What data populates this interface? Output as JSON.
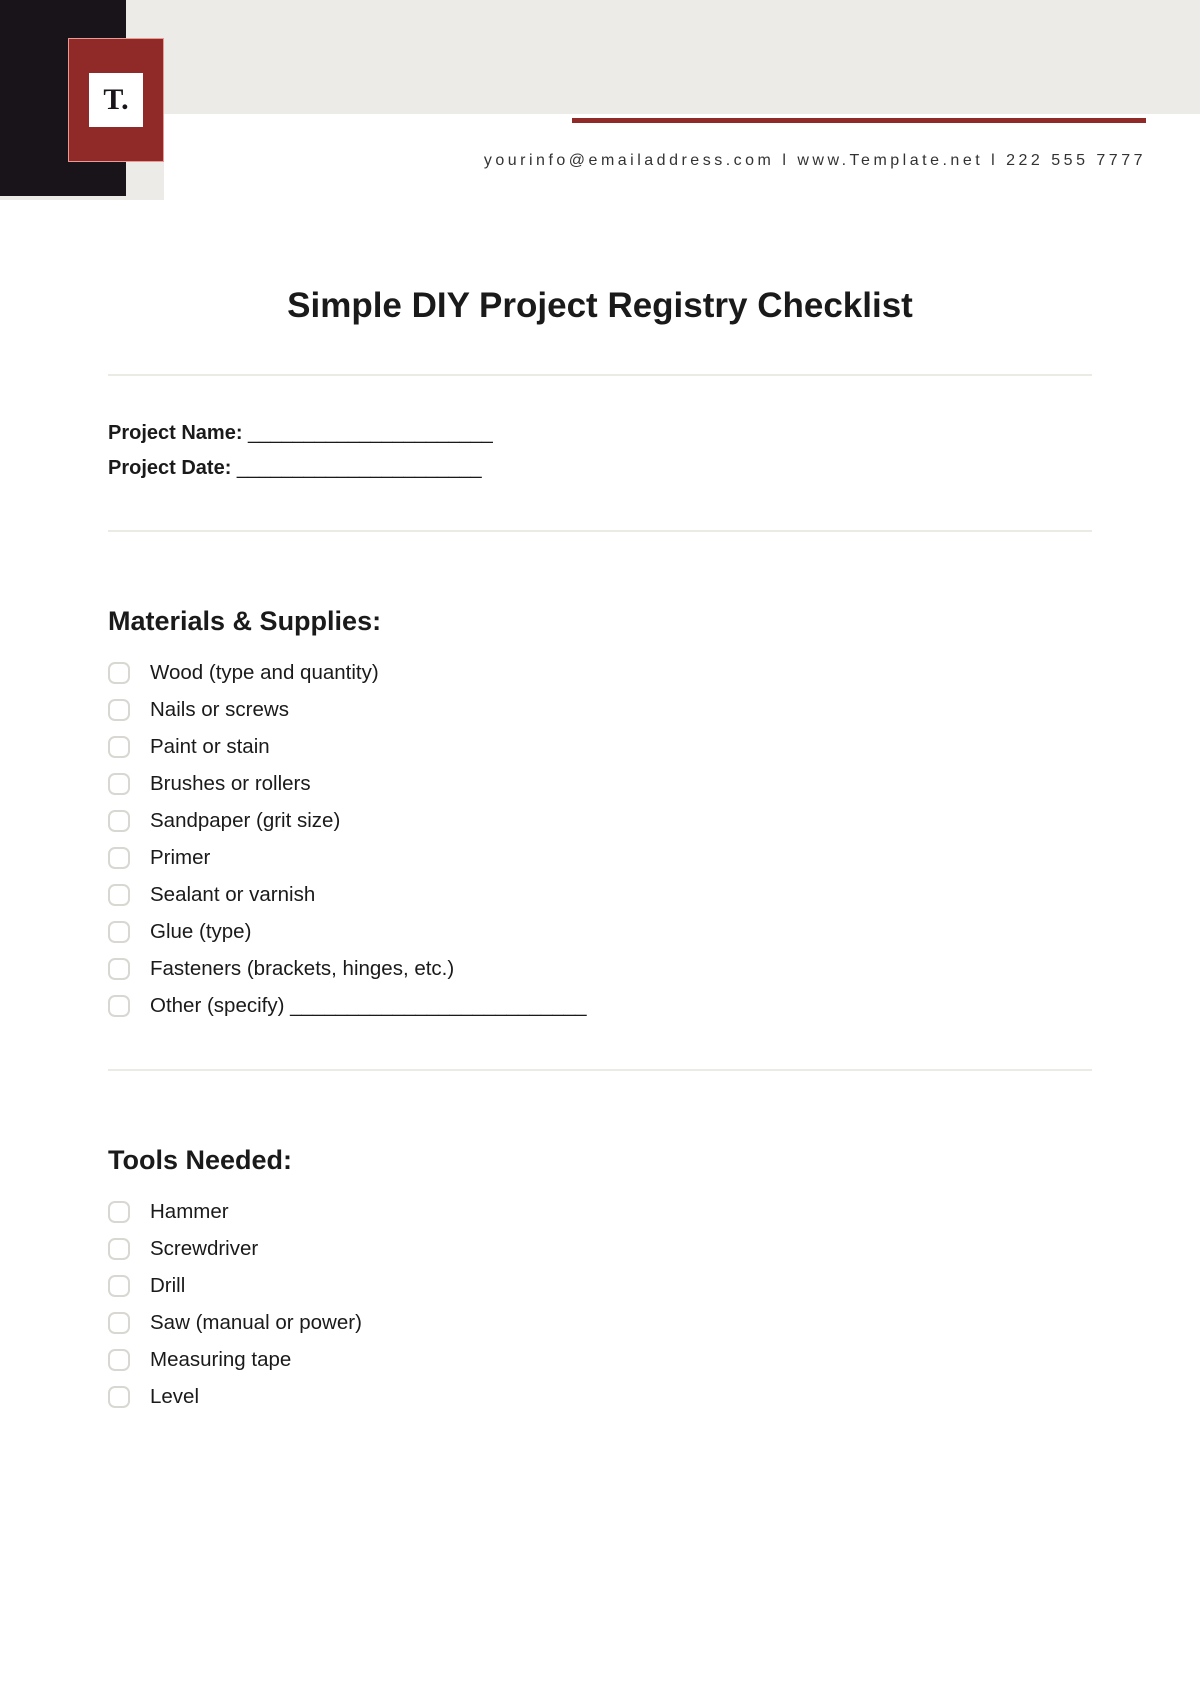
{
  "logo": {
    "text": "T."
  },
  "contact": {
    "email": "yourinfo@emailaddress.com",
    "separator": "  l  ",
    "website": "www.Template.net",
    "phone": "222 555 7777"
  },
  "title": "Simple DIY Project Registry Checklist",
  "meta": {
    "name_label": "Project Name:",
    "name_fill": " ______________________",
    "date_label": "Project Date:",
    "date_fill": " ______________________"
  },
  "sections": [
    {
      "heading": "Materials & Supplies:",
      "items": [
        "Wood (type and quantity)",
        "Nails or screws",
        "Paint or stain",
        "Brushes or rollers",
        "Sandpaper (grit size)",
        "Primer",
        "Sealant or varnish",
        "Glue (type)",
        "Fasteners (brackets, hinges, etc.)",
        "Other (specify) __________________________"
      ]
    },
    {
      "heading": "Tools Needed:",
      "items": [
        "Hammer",
        "Screwdriver",
        "Drill",
        "Saw (manual or power)",
        "Measuring tape",
        "Level"
      ]
    }
  ]
}
